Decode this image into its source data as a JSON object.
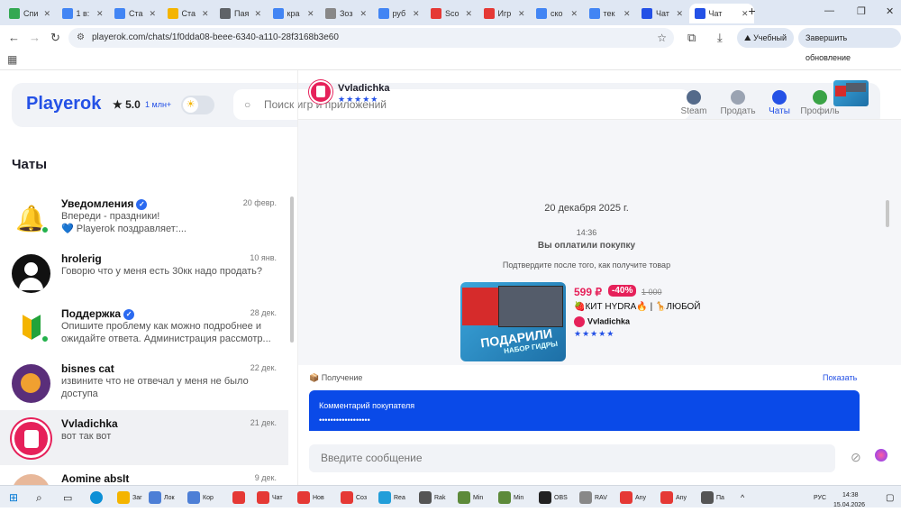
{
  "browser": {
    "tabs": [
      {
        "label": "Спи",
        "color": "#34a853"
      },
      {
        "label": "1 в:",
        "color": "#4285f4"
      },
      {
        "label": "Ста",
        "color": "#4285f4"
      },
      {
        "label": "Ста",
        "color": "#f4b400"
      },
      {
        "label": "Пая",
        "color": "#5f6368"
      },
      {
        "label": "кра",
        "color": "#4285f4"
      },
      {
        "label": "Зоз",
        "color": "#888888"
      },
      {
        "label": "руб",
        "color": "#4285f4"
      },
      {
        "label": "Sco",
        "color": "#e53935"
      },
      {
        "label": "Игр",
        "color": "#e53935"
      },
      {
        "label": "ско",
        "color": "#4285f4"
      },
      {
        "label": "тек",
        "color": "#4285f4"
      },
      {
        "label": "Чат",
        "color": "#2451e6"
      },
      {
        "label": "Чат",
        "color": "#2451e6",
        "active": true
      }
    ],
    "new_tab": "+",
    "url": "playerok.com/chats/1f0dda08-beee-6340-a110-28f3168b3e60",
    "profile_label": "Учебный",
    "update_label": "Завершить обновление"
  },
  "header": {
    "logo": "Playerok",
    "rating": "★ 5.0",
    "rating_count": "1 млн+",
    "search_placeholder": "Поиск игр и приложений",
    "nav": [
      {
        "label": "Steam",
        "color": "#546a8a"
      },
      {
        "label": "Продать",
        "color": "#9aa3b2"
      },
      {
        "label": "Чаты",
        "color": "#2451e6",
        "active": true
      },
      {
        "label": "Профиль",
        "color": "#3aa346"
      }
    ]
  },
  "sidebar": {
    "title": "Чаты",
    "chats": [
      {
        "name": "Уведомления",
        "verified": true,
        "date": "20 февр.",
        "line1": "Впереди - праздники!",
        "line2": "💙 Playerok поздравляет:...",
        "online": true,
        "avatar": "bell"
      },
      {
        "name": "hrolerig",
        "verified": false,
        "date": "10 янв.",
        "line1": "Говорю что у меня есть 30кк надо продать?",
        "line2": "",
        "online": false,
        "avatar": "user"
      },
      {
        "name": "Поддержка",
        "verified": true,
        "date": "28 дек.",
        "line1": "Опишите проблему как можно подробнее и",
        "line2": "ожидайте ответа. Администрация рассмотр...",
        "online": true,
        "avatar": "support"
      },
      {
        "name": "bisnes cat",
        "verified": false,
        "date": "22 дек.",
        "line1": "извините что не отвечал у меня не было",
        "line2": "доступа",
        "online": false,
        "avatar": "cat"
      },
      {
        "name": "Vvladichka",
        "verified": false,
        "date": "21 дек.",
        "line1": "вот так вот",
        "line2": "",
        "online": false,
        "avatar": "vv",
        "selected": true
      },
      {
        "name": "Aomine absIt",
        "verified": false,
        "date": "9 дек.",
        "line1": "",
        "line2": "",
        "online": false,
        "avatar": "face"
      }
    ]
  },
  "chat": {
    "partner_name": "Vvladichka",
    "partner_stars": "★★★★★",
    "date_divider": "20 декабря 2025 г.",
    "time": "14:36",
    "event_title": "Вы оплатили покупку",
    "event_subtitle": "Подтвердите после того, как получите товар",
    "product": {
      "price": "599 ₽",
      "discount": "-40%",
      "old_price": "1 000",
      "title": "🍓КИТ HYDRA🔥 | 🦒ЛЮБОЙ",
      "seller": "Vvladichka",
      "stars": "★★★★★",
      "thumb_caption": "ПОДАРИЛИ",
      "thumb_sub": "НАБОР ГИДРЫ"
    },
    "receive_label": "📦 Получение",
    "show_label": "Показать",
    "comment_title": "Комментарий покупателя",
    "comment_value": "••••••••••••••••••",
    "input_placeholder": "Введите сообщение"
  },
  "taskbar": {
    "apps": [
      {
        "label": "Заг",
        "color": "#f4b400"
      },
      {
        "label": "Лок",
        "color": "#4d7fd6"
      },
      {
        "label": "Кор",
        "color": "#4d7fd6"
      },
      {
        "label": "",
        "color": "#e53935"
      },
      {
        "label": "Чат",
        "color": "#e53935"
      },
      {
        "label": "Нов",
        "color": "#e53935"
      },
      {
        "label": "Соз",
        "color": "#e53935"
      },
      {
        "label": "Rea",
        "color": "#229ed9"
      },
      {
        "label": "Rak",
        "color": "#555555"
      },
      {
        "label": "Min",
        "color": "#5d8a3a"
      },
      {
        "label": "Min",
        "color": "#5d8a3a"
      },
      {
        "label": "OBS",
        "color": "#222222"
      },
      {
        "label": "RAV",
        "color": "#888888"
      },
      {
        "label": "Any",
        "color": "#e53935"
      },
      {
        "label": "Any",
        "color": "#e53935"
      },
      {
        "label": "Па",
        "color": "#555555"
      }
    ],
    "lang": "РУС",
    "time": "14:38",
    "date": "15.04.2026"
  }
}
